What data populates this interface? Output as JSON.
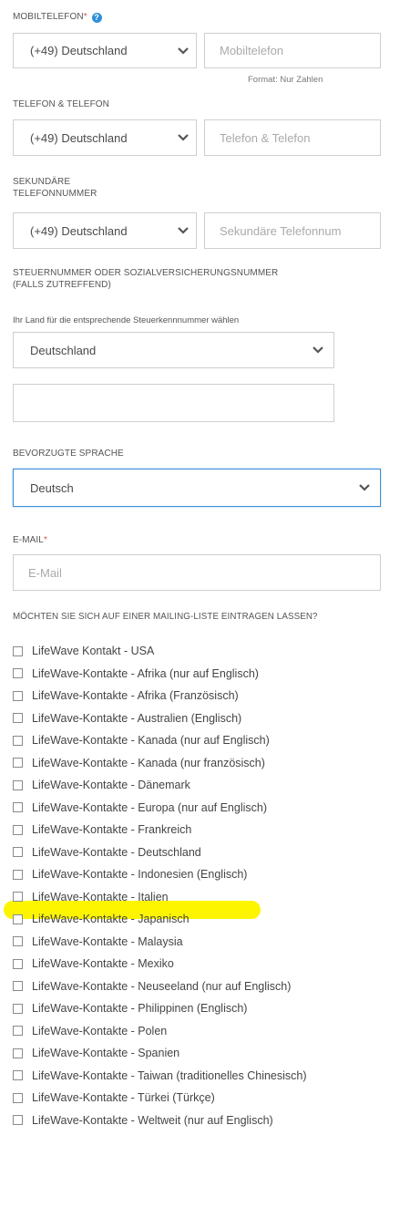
{
  "mobile": {
    "label": "MOBILTELEFON",
    "required_mark": "*",
    "help_icon": "question-circle-icon",
    "country_value": "(+49) Deutschland",
    "placeholder": "Mobiltelefon",
    "hint": "Format: Nur Zahlen"
  },
  "phone": {
    "label": "TELEFON & TELEFON",
    "country_value": "(+49) Deutschland",
    "placeholder": "Telefon & Telefon"
  },
  "secondary_phone": {
    "label_line1": "SEKUNDÄRE",
    "label_line2": "TELEFONNUMMER",
    "country_value": "(+49) Deutschland",
    "placeholder": "Sekundäre Telefonnum"
  },
  "tax": {
    "label_line1": "STEUERNUMMER ODER SOZIALVERSICHERUNGSNUMMER",
    "label_line2": "(FALLS ZUTREFFEND)",
    "sublabel": "Ihr Land für die entsprechende Steuerkennnummer wählen",
    "country_value": "Deutschland",
    "number_value": ""
  },
  "language": {
    "label": "BEVORZUGTE SPRACHE",
    "value": "Deutsch",
    "accent_color": "#3d8fd8"
  },
  "email": {
    "label": "E-MAIL",
    "required_mark": "*",
    "placeholder": "E-Mail"
  },
  "mailing": {
    "label": "MÖCHTEN SIE SICH AUF EINER MAILING-LISTE EINTRAGEN LASSEN?",
    "highlight_color": "#fdf500",
    "items": [
      "LifeWave Kontakt - USA",
      "LifeWave-Kontakte - Afrika (nur auf Englisch)",
      "LifeWave-Kontakte - Afrika (Französisch)",
      "LifeWave-Kontakte - Australien (Englisch)",
      "LifeWave-Kontakte - Kanada (nur auf Englisch)",
      "LifeWave-Kontakte - Kanada (nur französisch)",
      "LifeWave-Kontakte - Dänemark",
      "LifeWave-Kontakte - Europa (nur auf Englisch)",
      "LifeWave-Kontakte - Frankreich",
      "LifeWave-Kontakte - Deutschland",
      "LifeWave-Kontakte - Indonesien (Englisch)",
      "LifeWave-Kontakte - Italien",
      "LifeWave-Kontakte - Japanisch",
      "LifeWave-Kontakte - Malaysia",
      "LifeWave-Kontakte - Mexiko",
      "LifeWave-Kontakte - Neuseeland (nur auf Englisch)",
      "LifeWave-Kontakte - Philippinen (Englisch)",
      "LifeWave-Kontakte - Polen",
      "LifeWave-Kontakte - Spanien",
      "LifeWave-Kontakte - Taiwan (traditionelles Chinesisch)",
      "LifeWave-Kontakte - Türkei (Türkçe)",
      "LifeWave-Kontakte - Weltweit (nur auf Englisch)"
    ],
    "highlighted_index": 9
  }
}
